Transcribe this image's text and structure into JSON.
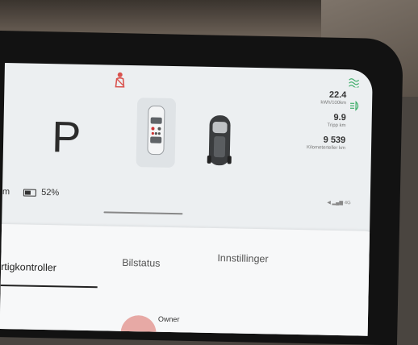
{
  "drive": {
    "gear": "P"
  },
  "stats": {
    "energy_value": "22.4",
    "energy_label": "kWh/100km",
    "trip_value": "9.9",
    "trip_label": "Tripp km",
    "odometer_value": "9 539",
    "odometer_label": "Kilometerteller km"
  },
  "status": {
    "range_unit": "m",
    "battery_percent": "52%",
    "signal": "4G"
  },
  "tabs": [
    {
      "label": "rtigkontroller",
      "active": true
    },
    {
      "label": "Bilstatus",
      "active": false
    },
    {
      "label": "Innstillinger",
      "active": false
    }
  ],
  "profile": {
    "name": "Owner"
  },
  "colors": {
    "seatbelt_warning": "#d9534f",
    "climate": "#3fae6a",
    "accent": "#222222"
  }
}
